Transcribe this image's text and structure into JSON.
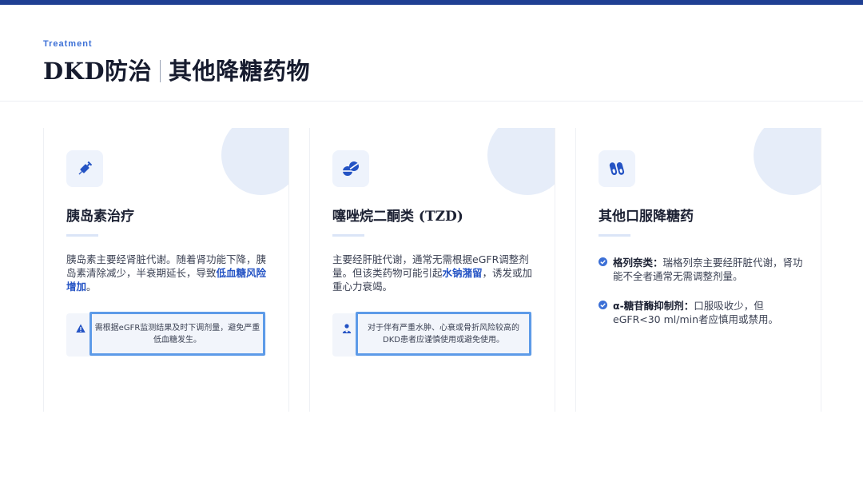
{
  "header": {
    "eyebrow": "Treatment",
    "title_main": "DKD防治",
    "title_sub": "其他降糖药物"
  },
  "cards": [
    {
      "icon": "syringe-icon",
      "title": "胰岛素治疗",
      "text_before": "胰岛素主要经肾脏代谢。随着肾功能下降，胰岛素清除减少，半衰期延长，导致",
      "highlight": "低血糖风险增加",
      "text_after": "。",
      "notice_icon": "warning-icon",
      "notice": "需根据eGFR监测结果及时下调剂量，避免严重低血糖发生。"
    },
    {
      "icon": "pills-icon",
      "title": "噻唑烷二酮类 (TZD)",
      "text_before": "主要经肝脏代谢，通常无需根据eGFR调整剂量。但该类药物可能引起",
      "highlight": "水钠潴留",
      "text_after": "，诱发或加重心力衰竭。",
      "notice_icon": "doctor-icon",
      "notice": "对于伴有严重水肿、心衰或骨折风险较高的DKD患者应谨慎使用或避免使用。"
    },
    {
      "icon": "capsules-icon",
      "title": "其他口服降糖药",
      "bullets": [
        {
          "label": "格列奈类：",
          "text": "瑞格列奈主要经肝脏代谢，肾功能不全者通常无需调整剂量。"
        },
        {
          "label": "α-糖苷酶抑制剂：",
          "text": "口服吸收少，但eGFR<30 ml/min者应慎用或禁用。"
        }
      ]
    }
  ],
  "colors": {
    "accent": "#1f3f93",
    "highlight": "#2453c4",
    "notice_border": "#5d9be8"
  }
}
